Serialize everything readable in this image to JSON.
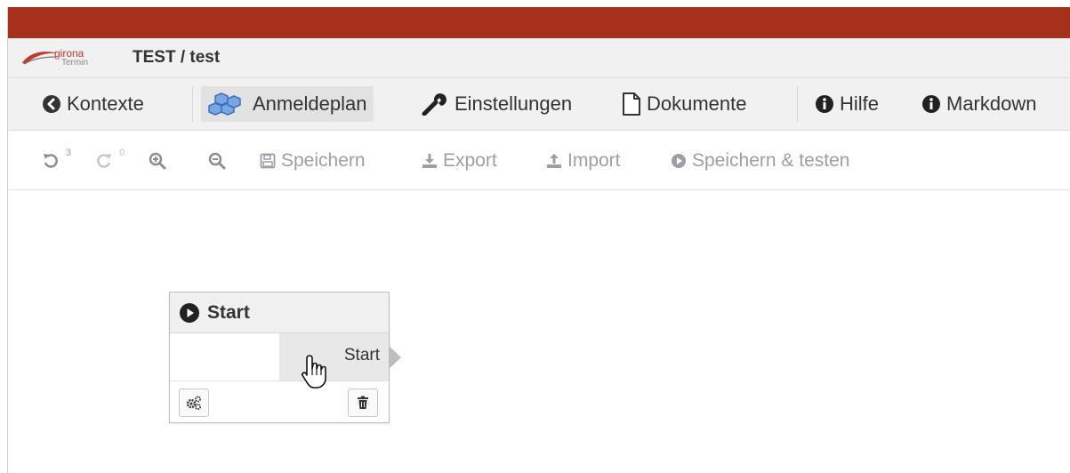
{
  "header": {
    "brand_color": "#a6301b",
    "logo": {
      "line1": "girona",
      "line2": "Termin"
    },
    "title": "TEST / test"
  },
  "nav": {
    "items": [
      {
        "label": "Kontexte",
        "icon": "arrow-circle-left-icon"
      },
      {
        "label": "Anmeldeplan",
        "icon": "cubes-icon",
        "active": true
      },
      {
        "label": "Einstellungen",
        "icon": "wrench-icon"
      },
      {
        "label": "Dokumente",
        "icon": "document-icon"
      },
      {
        "label": "Hilfe",
        "icon": "info-circle-icon"
      },
      {
        "label": "Markdown",
        "icon": "info-circle-icon"
      }
    ]
  },
  "toolbar": {
    "undo_count": "3",
    "redo_count": "0",
    "save_label": "Speichern",
    "export_label": "Export",
    "import_label": "Import",
    "save_test_label": "Speichern & testen"
  },
  "node": {
    "title": "Start",
    "port_label": "Start"
  }
}
